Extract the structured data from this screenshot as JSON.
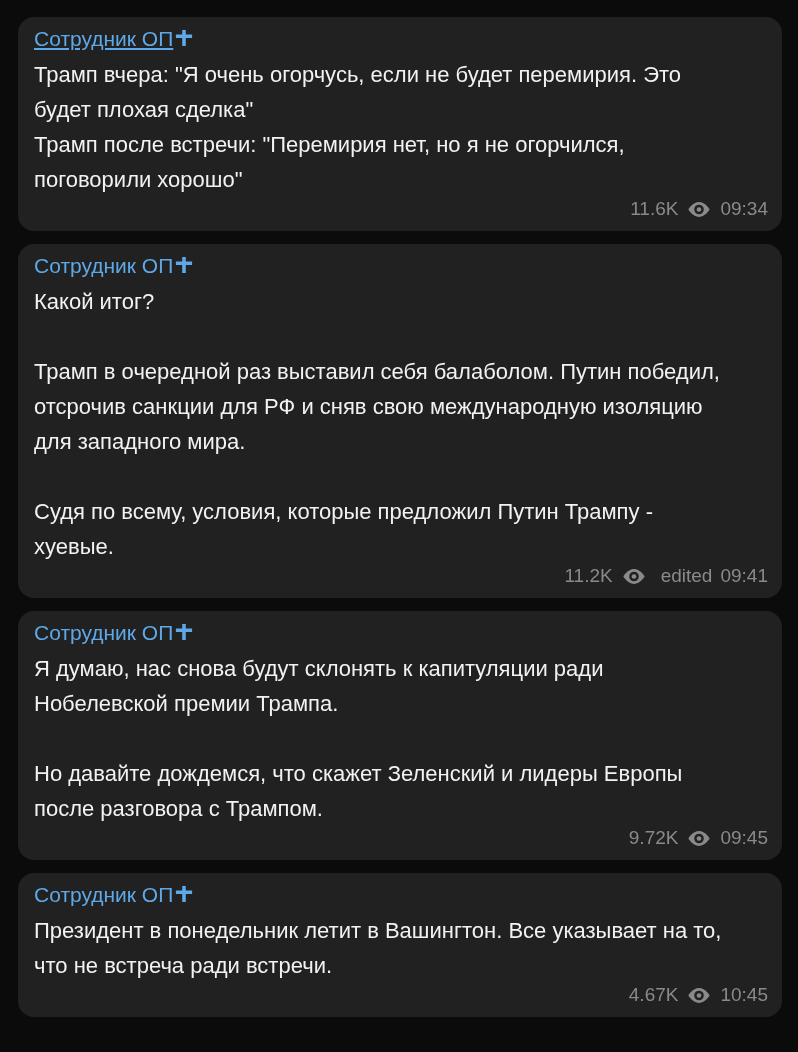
{
  "messages": [
    {
      "author": "Сотрудник ОП",
      "hovered": true,
      "paragraphs": [
        "Трамп вчера: \"Я очень огорчусь, если не будет перемирия. Это будет плохая сделка\"\nТрамп после встречи: \"Перемирия нет, но я не огорчился, поговорили хорошо\""
      ],
      "views": "11.6K",
      "time": "09:34"
    },
    {
      "author": "Сотрудник ОП",
      "hovered": false,
      "paragraphs": [
        "Какой итог?",
        "Трамп в очередной раз выставил себя балаболом. Путин победил, отсрочив санкции для РФ и сняв свою международную изоляцию для западного мира.",
        "Судя по всему, условия, которые предложил Путин Трампу - хуевые."
      ],
      "views": "11.2K",
      "edited": "edited",
      "time": "09:41"
    },
    {
      "author": "Сотрудник ОП",
      "hovered": false,
      "paragraphs": [
        "Я думаю, нас снова будут склонять к капитуляции ради Нобелевской премии Трампа.",
        "Но давайте дождемся, что скажет Зеленский и лидеры Европы после разговора с Трампом."
      ],
      "views": "9.72K",
      "time": "09:45"
    },
    {
      "author": "Сотрудник ОП",
      "hovered": false,
      "paragraphs": [
        "Президент в понедельник летит в Вашингтон. Все указывает на то, что не встреча ради встречи."
      ],
      "views": "4.67K",
      "time": "10:45"
    }
  ]
}
